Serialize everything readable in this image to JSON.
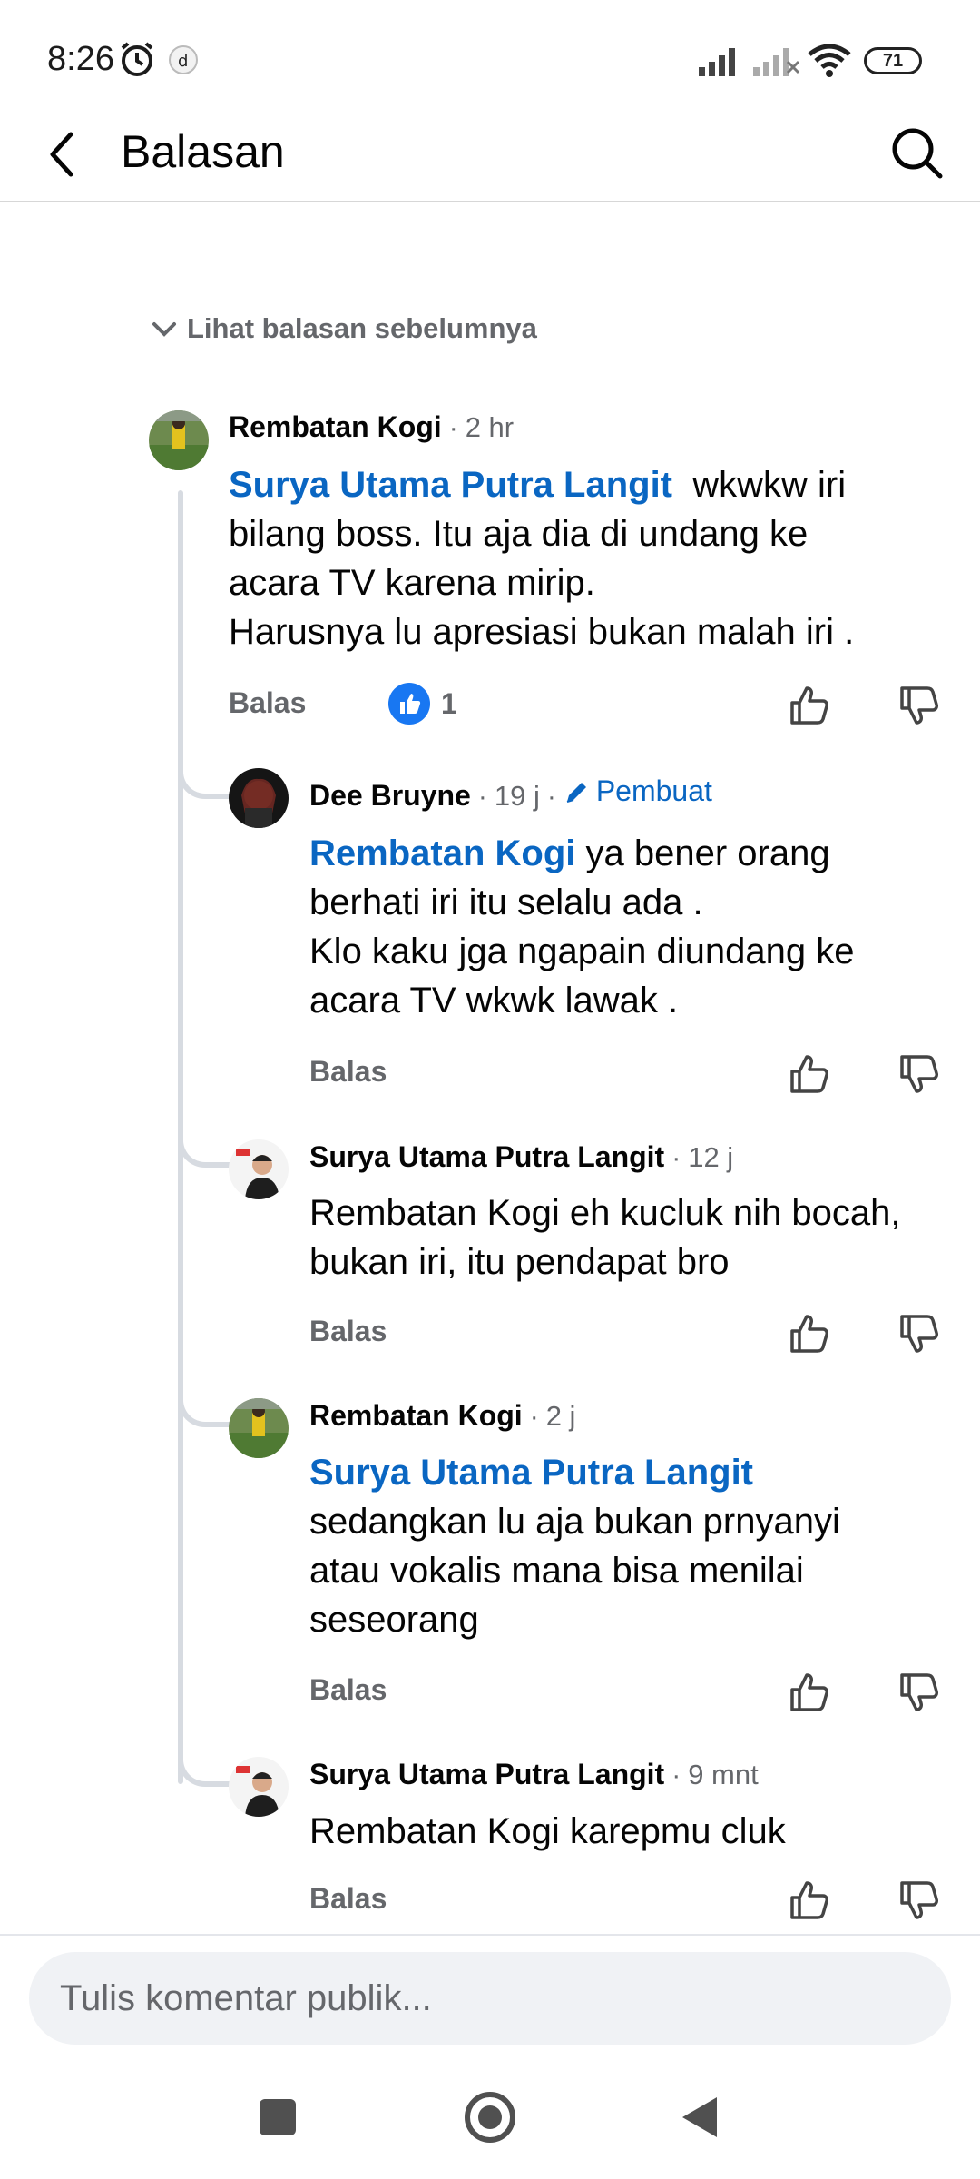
{
  "status_bar": {
    "time": "8:26",
    "battery": "71"
  },
  "header": {
    "title": "Balasan"
  },
  "prev_replies_label": "Lihat balasan sebelumnya",
  "comments": [
    {
      "author": "Rembatan Kogi",
      "time": "2 hr",
      "mention": "Surya Utama Putra Langit",
      "lines": [
        "wkwkw iri",
        "bilang boss. Itu aja dia di undang ke",
        "acara TV karena mirip.",
        "Harusnya lu apresiasi bukan malah iri ."
      ],
      "reply_label": "Balas",
      "like_count": "1"
    },
    {
      "author": "Dee Bruyne",
      "time": "19 j",
      "creator_badge": "Pembuat",
      "mention": "Rembatan Kogi",
      "lines": [
        "ya bener orang",
        "berhati iri itu selalu ada  .",
        "Klo kaku jga ngapain diundang ke",
        "acara TV wkwk lawak ."
      ],
      "reply_label": "Balas"
    },
    {
      "author": "Surya Utama Putra Langit",
      "time": "12 j",
      "lines": [
        "Rembatan Kogi eh kucluk nih bocah,",
        "bukan iri, itu pendapat bro"
      ],
      "reply_label": "Balas"
    },
    {
      "author": "Rembatan Kogi",
      "time": "2 j",
      "mention": "Surya Utama Putra Langit",
      "lines": [
        "sedangkan lu aja bukan prnyanyi",
        "atau vokalis mana bisa menilai",
        "seseorang"
      ],
      "reply_label": "Balas"
    },
    {
      "author": "Surya Utama Putra Langit",
      "time": "9 mnt",
      "lines": [
        "Rembatan Kogi karepmu cluk"
      ],
      "reply_label": "Balas"
    }
  ],
  "composer": {
    "placeholder": "Tulis komentar publik..."
  },
  "colors": {
    "link": "#0a66c2",
    "like_blue": "#1877f2",
    "muted": "#65676b"
  },
  "icons": [
    "back-arrow-icon",
    "search-icon",
    "chevron-down-icon",
    "thumbs-up-icon",
    "thumbs-down-icon",
    "pencil-icon",
    "alarm-icon",
    "wifi-icon",
    "signal-icon",
    "battery-icon"
  ]
}
